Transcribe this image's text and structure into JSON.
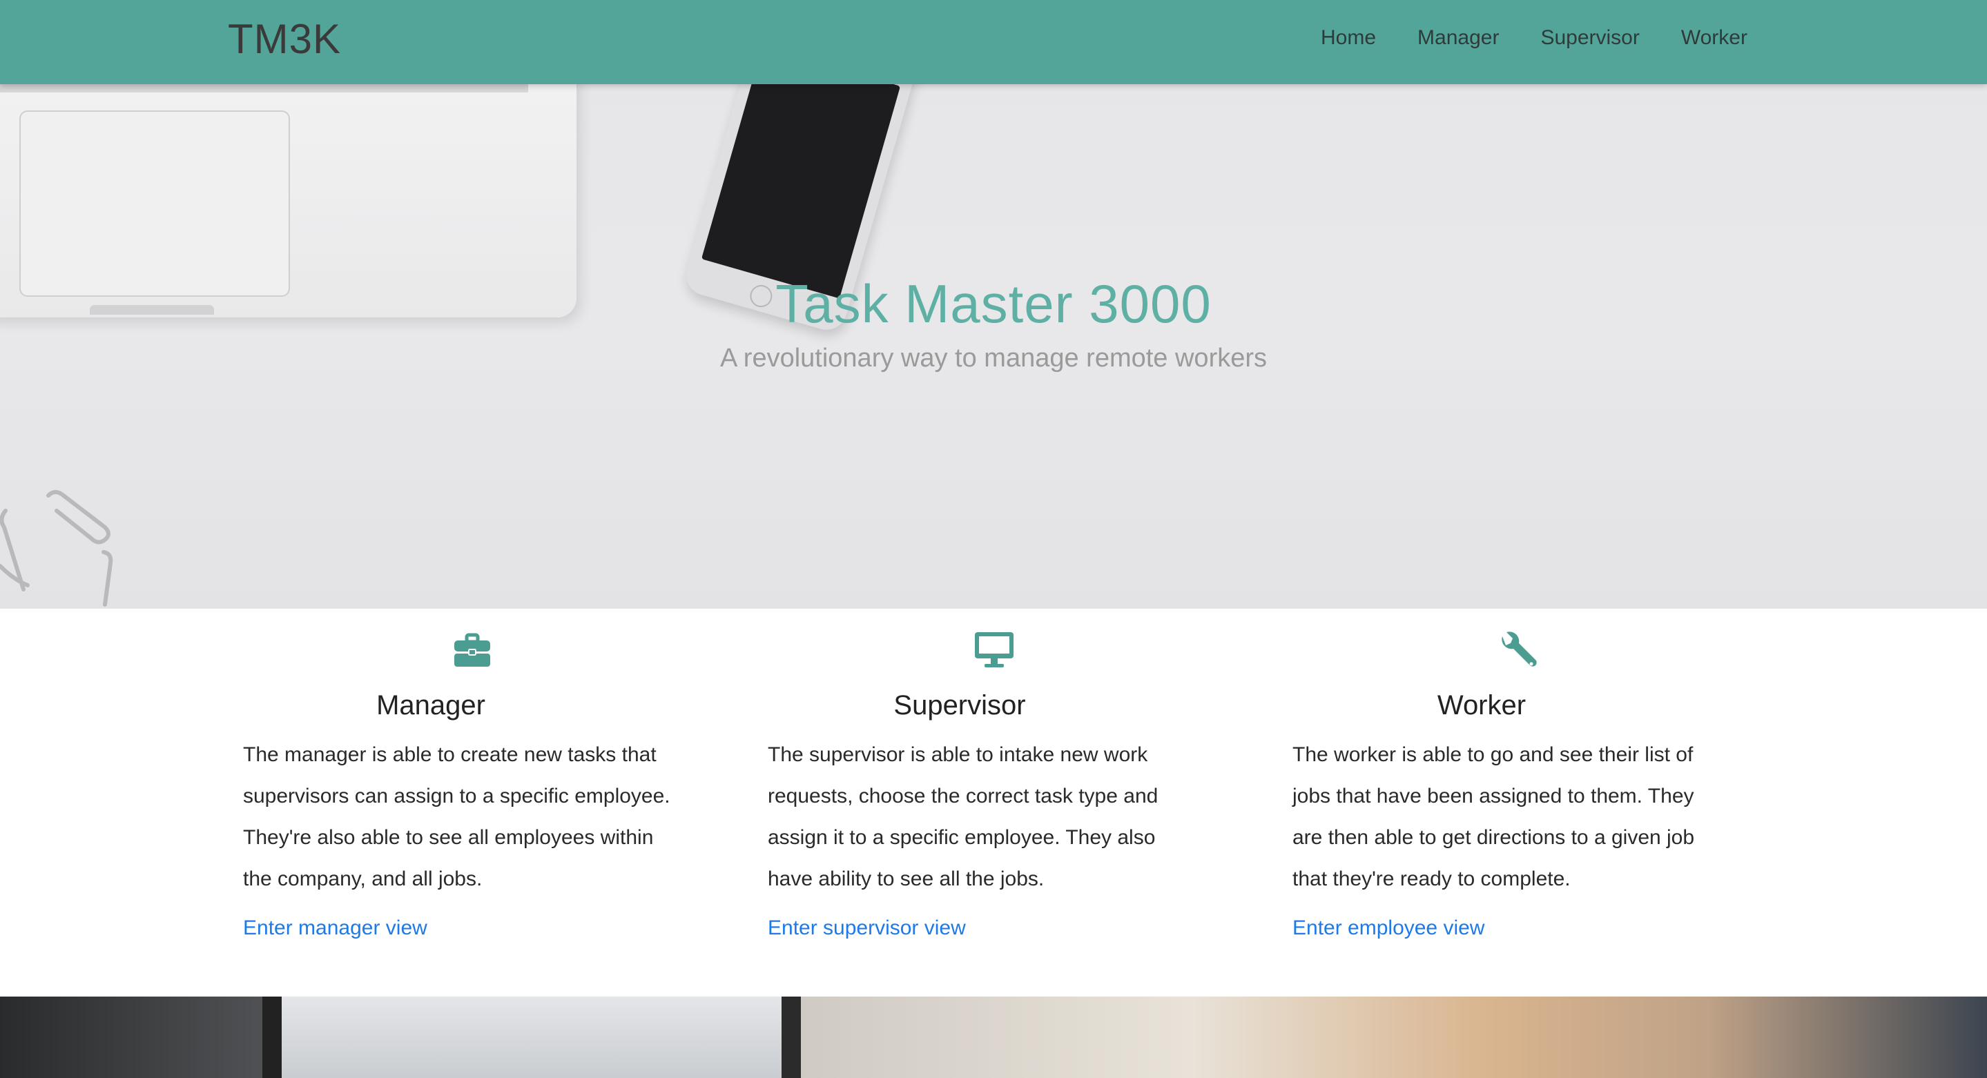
{
  "navbar": {
    "brand": "TM3K",
    "links": [
      "Home",
      "Manager",
      "Supervisor",
      "Worker"
    ]
  },
  "hero": {
    "title": "Task Master 3000",
    "subtitle": "A revolutionary way to manage remote workers"
  },
  "features": [
    {
      "icon": "briefcase-icon",
      "title": "Manager",
      "text": "The manager is able to create new tasks that supervisors can assign to a specific employee. They're also able to see all employees within the company, and all jobs.",
      "link": "Enter manager view"
    },
    {
      "icon": "desktop-icon",
      "title": "Supervisor",
      "text": "The supervisor is able to intake new work requests, choose the correct task type and assign it to a specific employee. They also have ability to see all the jobs.",
      "link": "Enter supervisor view"
    },
    {
      "icon": "wrench-icon",
      "title": "Worker",
      "text": "The worker is able to go and see their list of jobs that have been assigned to them. They are then able to get directions to a given job that they're ready to complete.",
      "link": "Enter employee view"
    }
  ],
  "colors": {
    "navbar": "#53a59a",
    "accent": "#4a9d90",
    "link": "#1e7ae6"
  }
}
